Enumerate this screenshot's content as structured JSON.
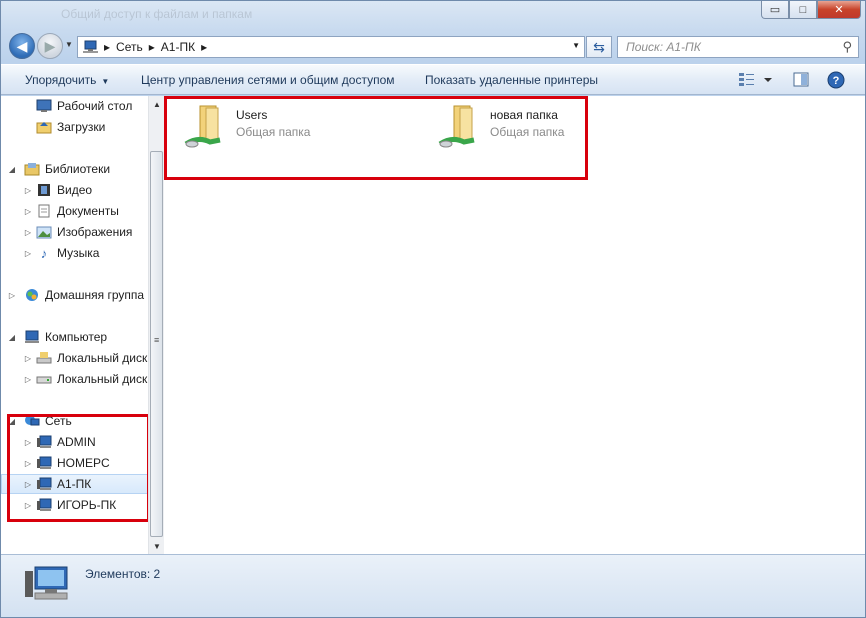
{
  "window": {
    "ghost_title": "Общий доступ к файлам и папкам",
    "controls": {
      "minimize": "▭",
      "maximize": "□",
      "close": "✕"
    }
  },
  "address": {
    "crumbs": [
      "Сеть",
      "A1-ПК"
    ],
    "separator": "▸"
  },
  "search": {
    "placeholder": "Поиск: A1-ПК"
  },
  "toolbar": {
    "organize": "Упорядочить",
    "network_center": "Центр управления сетями и общим доступом",
    "show_printers": "Показать удаленные принтеры"
  },
  "sidebar": {
    "favorites": [
      "Рабочий стол",
      "Загрузки"
    ],
    "libraries_title": "Библиотеки",
    "libraries": [
      "Видео",
      "Документы",
      "Изображения",
      "Музыка"
    ],
    "homegroup": "Домашняя группа",
    "computer_title": "Компьютер",
    "drives": [
      "Локальный диск",
      "Локальный диск"
    ],
    "network_title": "Сеть",
    "network_nodes": [
      "ADMIN",
      "HOMEPC",
      "A1-ПК",
      "ИГОРЬ-ПК"
    ],
    "selected_node": "A1-ПК"
  },
  "content": {
    "items": [
      {
        "name": "Users",
        "type": "Общая папка"
      },
      {
        "name": "новая папка",
        "type": "Общая папка"
      }
    ]
  },
  "status": {
    "text": "Элементов: 2"
  },
  "colors": {
    "highlight_border": "#d8000c",
    "folder": "#f2d27a",
    "share_cable": "#3aa64a"
  }
}
